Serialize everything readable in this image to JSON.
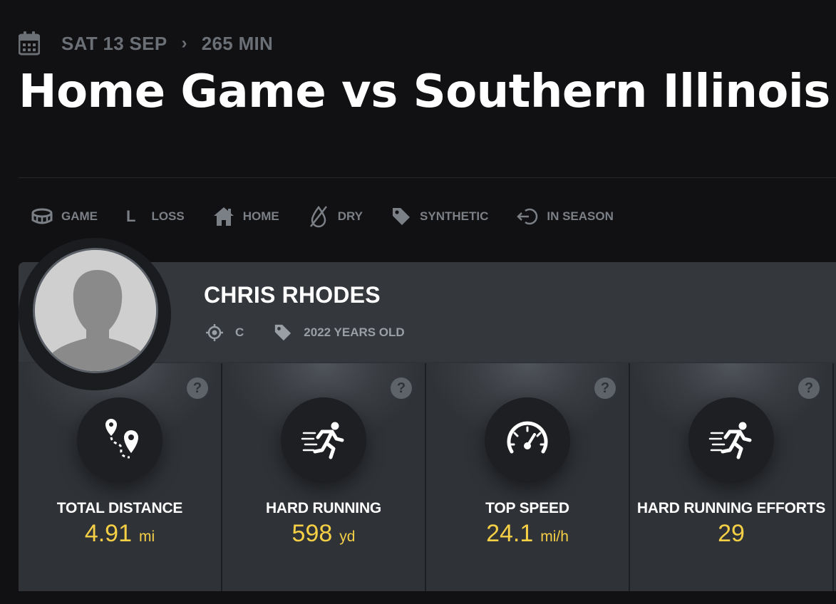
{
  "header": {
    "date": "SAT 13 SEP",
    "separator": "›",
    "duration": "265 MIN",
    "title": "Home Game vs Southern Illinois"
  },
  "tags": [
    {
      "icon": "stadium-icon",
      "label": "GAME"
    },
    {
      "icon": "L",
      "label": "LOSS"
    },
    {
      "icon": "home-icon",
      "label": "HOME"
    },
    {
      "icon": "dry-icon",
      "label": "DRY"
    },
    {
      "icon": "tag-icon",
      "label": "SYNTHETIC"
    },
    {
      "icon": "in-season-icon",
      "label": "IN SEASON"
    }
  ],
  "player": {
    "name": "CHRIS RHODES",
    "position": "C",
    "age": "2022 YEARS OLD"
  },
  "stats": [
    {
      "icon": "route-icon",
      "label": "TOTAL DISTANCE",
      "value": "4.91",
      "unit": "mi"
    },
    {
      "icon": "running-icon",
      "label": "HARD RUNNING",
      "value": "598",
      "unit": "yd"
    },
    {
      "icon": "speedometer-icon",
      "label": "TOP SPEED",
      "value": "24.1",
      "unit": "mi/h"
    },
    {
      "icon": "running-icon",
      "label": "HARD RUNNING EFFORTS",
      "value": "29",
      "unit": ""
    }
  ],
  "help_glyph": "?",
  "colors": {
    "background": "#111113",
    "card": "#2f3237",
    "accent": "#f5cf45",
    "muted": "#6b6f76"
  }
}
